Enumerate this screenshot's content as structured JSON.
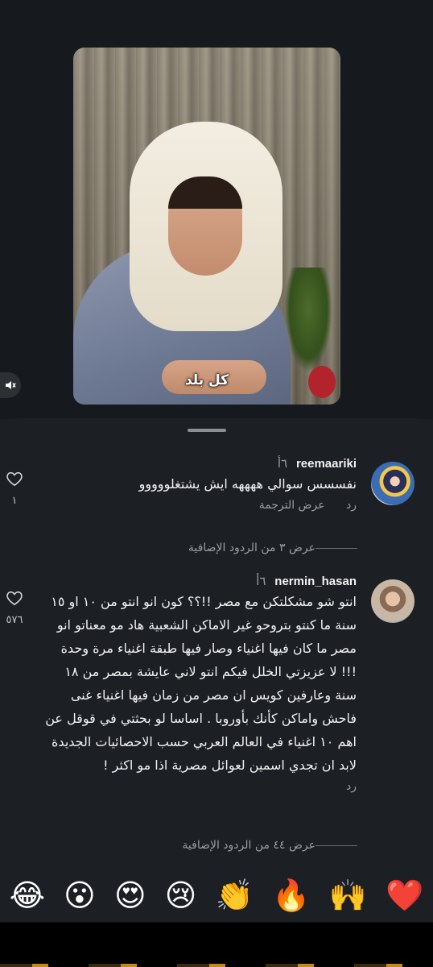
{
  "video": {
    "caption": "كل بلد"
  },
  "comments": [
    {
      "username": "reemaariki",
      "time": "٦أ",
      "text": "نفسسس سوالي ههههه ايش يشتغلووووو",
      "reply_label": "رد",
      "translate_label": "عرض الترجمة",
      "likes": "١",
      "more_replies": "عرض ٣ من الردود الإضافية"
    },
    {
      "username": "nermin_hasan",
      "time": "٦أ",
      "text": "انتو شو مشكلتكن مع مصر !!؟؟ كون انو انتو من ١٠ او ١٥ سنة ما كنتو بتروحو غير الاماكن الشعبية هاد مو معناتو انو مصر ما كان فيها اغنياء وصار فيها طبقة اغنياء مرة وحدة !!! لا عزيزتي الخلل فيكم انتو لاني عايشة بمصر من ١٨ سنة وعارفين كويس ان مصر من زمان فيها اغنياء غنى فاحش واماكن كأنك بأوروبا . اساسا لو بحثتي في قوقل عن اهم ١٠ اغنياء في العالم العربي حسب الاحصائيات الجديدة لابد ان تجدي اسمين لعوائل مصرية اذا مو اكثر !",
      "reply_label": "رد",
      "likes": "٥٧٦",
      "more_replies": "عرض ٤٤ من الردود الإضافية"
    }
  ],
  "emojis": [
    "😂",
    "😮",
    "😍",
    "😢",
    "👏",
    "🔥",
    "🙌",
    "❤️"
  ],
  "icons": {
    "mute": "speaker-muted-icon",
    "like": "heart-outline-icon"
  }
}
